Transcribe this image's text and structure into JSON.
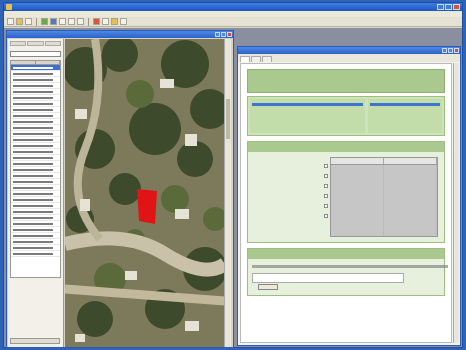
{
  "window": {
    "title": ""
  },
  "menu": {
    "items": [
      "",
      "",
      "",
      "",
      "",
      "",
      "",
      ""
    ]
  },
  "imagery_window": {
    "title": ""
  },
  "parcel_list": {
    "tabs": [
      "",
      "",
      ""
    ],
    "search_value": "",
    "columns": [
      "",
      ""
    ],
    "selected_index": 0,
    "row_count": 32
  },
  "planning_window": {
    "title": "",
    "tabs": [
      "",
      "",
      ""
    ],
    "header": {
      "title": "",
      "subtitle": ""
    },
    "info_left": {
      "title": "",
      "label": ""
    },
    "info_right": {
      "title": "",
      "label": ""
    },
    "section_one": {
      "title": "",
      "columns": [
        "",
        ""
      ],
      "labels": [
        "",
        "",
        "",
        "",
        "",
        ""
      ]
    },
    "section_two": {
      "title": ""
    }
  },
  "colors": {
    "accent_blue": "#3f73d1",
    "panel_green": "#a9c98e",
    "parcel_highlight": "#e01414"
  }
}
